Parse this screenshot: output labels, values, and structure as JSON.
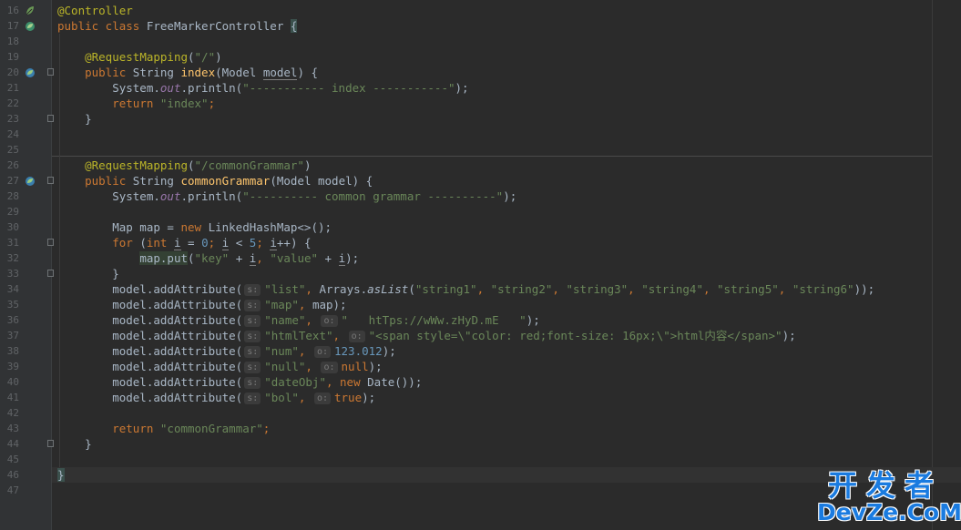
{
  "editor": {
    "lines": [
      {
        "n": "16",
        "icon": "spring-bean-icon",
        "segments": [
          {
            "c": "ann",
            "t": "@Controller"
          }
        ]
      },
      {
        "n": "17",
        "icon": "spring-bean-method-icon",
        "segments": [
          {
            "c": "kw",
            "t": "public class "
          },
          {
            "c": "",
            "t": "FreeMarkerController "
          },
          {
            "c": "hlb",
            "t": "{"
          }
        ]
      },
      {
        "n": "18",
        "segments": []
      },
      {
        "n": "19",
        "segments": [
          {
            "c": "",
            "t": "    "
          },
          {
            "c": "ann",
            "t": "@RequestMapping"
          },
          {
            "c": "",
            "t": "("
          },
          {
            "c": "str",
            "t": "\"/\""
          },
          {
            "c": "",
            "t": ")"
          }
        ]
      },
      {
        "n": "20",
        "icon": "spring-mapping-icon",
        "fold": true,
        "segments": [
          {
            "c": "",
            "t": "    "
          },
          {
            "c": "kw",
            "t": "public "
          },
          {
            "c": "",
            "t": "String "
          },
          {
            "c": "fn",
            "t": "index"
          },
          {
            "c": "",
            "t": "(Model "
          },
          {
            "c": "ul",
            "t": "model"
          },
          {
            "c": "",
            "t": ") {"
          }
        ]
      },
      {
        "n": "21",
        "segments": [
          {
            "c": "",
            "t": "        System."
          },
          {
            "c": "fld",
            "t": "out"
          },
          {
            "c": "",
            "t": ".println("
          },
          {
            "c": "str",
            "t": "\"----------- index -----------\""
          },
          {
            "c": "",
            "t": ");"
          }
        ]
      },
      {
        "n": "22",
        "segments": [
          {
            "c": "",
            "t": "        "
          },
          {
            "c": "kw",
            "t": "return "
          },
          {
            "c": "str",
            "t": "\"index\""
          },
          {
            "c": "kw",
            "t": ";"
          }
        ]
      },
      {
        "n": "23",
        "fold": true,
        "segments": [
          {
            "c": "",
            "t": "    }"
          }
        ]
      },
      {
        "n": "24",
        "segments": []
      },
      {
        "n": "25",
        "segments": []
      },
      {
        "n": "26",
        "segments": [
          {
            "c": "",
            "t": "    "
          },
          {
            "c": "ann",
            "t": "@RequestMapping"
          },
          {
            "c": "",
            "t": "("
          },
          {
            "c": "str",
            "t": "\"/commonGrammar\""
          },
          {
            "c": "",
            "t": ")"
          }
        ]
      },
      {
        "n": "27",
        "icon": "spring-mapping-icon",
        "fold": true,
        "segments": [
          {
            "c": "",
            "t": "    "
          },
          {
            "c": "kw",
            "t": "public "
          },
          {
            "c": "",
            "t": "String "
          },
          {
            "c": "fn",
            "t": "commonGrammar"
          },
          {
            "c": "",
            "t": "(Model model) {"
          }
        ]
      },
      {
        "n": "28",
        "segments": [
          {
            "c": "",
            "t": "        System."
          },
          {
            "c": "fld",
            "t": "out"
          },
          {
            "c": "",
            "t": ".println("
          },
          {
            "c": "str",
            "t": "\"---------- common grammar ----------\""
          },
          {
            "c": "",
            "t": ");"
          }
        ]
      },
      {
        "n": "29",
        "segments": []
      },
      {
        "n": "30",
        "segments": [
          {
            "c": "",
            "t": "        Map map = "
          },
          {
            "c": "kw",
            "t": "new "
          },
          {
            "c": "",
            "t": "LinkedHashMap<>();"
          }
        ]
      },
      {
        "n": "31",
        "fold": true,
        "segments": [
          {
            "c": "",
            "t": "        "
          },
          {
            "c": "kw",
            "t": "for "
          },
          {
            "c": "",
            "t": "("
          },
          {
            "c": "kw",
            "t": "int "
          },
          {
            "c": "ul",
            "t": "i"
          },
          {
            "c": "",
            "t": " = "
          },
          {
            "c": "num",
            "t": "0"
          },
          {
            "c": "kw",
            "t": "; "
          },
          {
            "c": "ul",
            "t": "i"
          },
          {
            "c": "",
            "t": " < "
          },
          {
            "c": "num",
            "t": "5"
          },
          {
            "c": "kw",
            "t": "; "
          },
          {
            "c": "ul",
            "t": "i"
          },
          {
            "c": "",
            "t": "++) {"
          }
        ]
      },
      {
        "n": "32",
        "segments": [
          {
            "c": "",
            "t": "            "
          },
          {
            "c": "hl",
            "t": "map.put"
          },
          {
            "c": "",
            "t": "("
          },
          {
            "c": "str",
            "t": "\"key\""
          },
          {
            "c": "",
            "t": " + "
          },
          {
            "c": "ul",
            "t": "i"
          },
          {
            "c": "kw",
            "t": ", "
          },
          {
            "c": "str",
            "t": "\"value\""
          },
          {
            "c": "",
            "t": " + "
          },
          {
            "c": "ul",
            "t": "i"
          },
          {
            "c": "",
            "t": ");"
          }
        ]
      },
      {
        "n": "33",
        "fold": true,
        "segments": [
          {
            "c": "",
            "t": "        }"
          }
        ]
      },
      {
        "n": "34",
        "segments": [
          {
            "c": "",
            "t": "        model.addAttribute("
          },
          {
            "c": "hint",
            "t": "s:"
          },
          {
            "c": "str",
            "t": "\"list\""
          },
          {
            "c": "kw",
            "t": ", "
          },
          {
            "c": "",
            "t": "Arrays."
          },
          {
            "c": "ital",
            "t": "asList"
          },
          {
            "c": "",
            "t": "("
          },
          {
            "c": "str",
            "t": "\"string1\""
          },
          {
            "c": "kw",
            "t": ", "
          },
          {
            "c": "str",
            "t": "\"string2\""
          },
          {
            "c": "kw",
            "t": ", "
          },
          {
            "c": "str",
            "t": "\"string3\""
          },
          {
            "c": "kw",
            "t": ", "
          },
          {
            "c": "str",
            "t": "\"string4\""
          },
          {
            "c": "kw",
            "t": ", "
          },
          {
            "c": "str",
            "t": "\"string5\""
          },
          {
            "c": "kw",
            "t": ", "
          },
          {
            "c": "str",
            "t": "\"string6\""
          },
          {
            "c": "",
            "t": "));"
          }
        ]
      },
      {
        "n": "35",
        "segments": [
          {
            "c": "",
            "t": "        model.addAttribute("
          },
          {
            "c": "hint",
            "t": "s:"
          },
          {
            "c": "str",
            "t": "\"map\""
          },
          {
            "c": "kw",
            "t": ", "
          },
          {
            "c": "",
            "t": "map);"
          }
        ]
      },
      {
        "n": "36",
        "segments": [
          {
            "c": "",
            "t": "        model.addAttribute("
          },
          {
            "c": "hint",
            "t": "s:"
          },
          {
            "c": "str",
            "t": "\"name\""
          },
          {
            "c": "kw",
            "t": ", "
          },
          {
            "c": "hint",
            "t": "o:"
          },
          {
            "c": "str",
            "t": "\"   htTps://wWw.zHyD.mE   \""
          },
          {
            "c": "",
            "t": ");"
          }
        ]
      },
      {
        "n": "37",
        "segments": [
          {
            "c": "",
            "t": "        model.addAttribute("
          },
          {
            "c": "hint",
            "t": "s:"
          },
          {
            "c": "str",
            "t": "\"htmlText\""
          },
          {
            "c": "kw",
            "t": ", "
          },
          {
            "c": "hint",
            "t": "o:"
          },
          {
            "c": "str",
            "t": "\"<span style=\\\"color: red;font-size: 16px;\\\">html内容</span>\""
          },
          {
            "c": "",
            "t": ");"
          }
        ]
      },
      {
        "n": "38",
        "segments": [
          {
            "c": "",
            "t": "        model.addAttribute("
          },
          {
            "c": "hint",
            "t": "s:"
          },
          {
            "c": "str",
            "t": "\"num\""
          },
          {
            "c": "kw",
            "t": ", "
          },
          {
            "c": "hint",
            "t": "o:"
          },
          {
            "c": "num",
            "t": "123.012"
          },
          {
            "c": "",
            "t": ");"
          }
        ]
      },
      {
        "n": "39",
        "segments": [
          {
            "c": "",
            "t": "        model.addAttribute("
          },
          {
            "c": "hint",
            "t": "s:"
          },
          {
            "c": "str",
            "t": "\"null\""
          },
          {
            "c": "kw",
            "t": ", "
          },
          {
            "c": "hint",
            "t": "o:"
          },
          {
            "c": "kw",
            "t": "null"
          },
          {
            "c": "",
            "t": ");"
          }
        ]
      },
      {
        "n": "40",
        "segments": [
          {
            "c": "",
            "t": "        model.addAttribute("
          },
          {
            "c": "hint",
            "t": "s:"
          },
          {
            "c": "str",
            "t": "\"dateObj\""
          },
          {
            "c": "kw",
            "t": ", new "
          },
          {
            "c": "",
            "t": "Date());"
          }
        ]
      },
      {
        "n": "41",
        "segments": [
          {
            "c": "",
            "t": "        model.addAttribute("
          },
          {
            "c": "hint",
            "t": "s:"
          },
          {
            "c": "str",
            "t": "\"bol\""
          },
          {
            "c": "kw",
            "t": ", "
          },
          {
            "c": "hint",
            "t": "o:"
          },
          {
            "c": "kw",
            "t": "true"
          },
          {
            "c": "",
            "t": ");"
          }
        ]
      },
      {
        "n": "42",
        "segments": []
      },
      {
        "n": "43",
        "segments": [
          {
            "c": "",
            "t": "        "
          },
          {
            "c": "kw",
            "t": "return "
          },
          {
            "c": "str",
            "t": "\"commonGrammar\""
          },
          {
            "c": "kw",
            "t": ";"
          }
        ]
      },
      {
        "n": "44",
        "fold": true,
        "segments": [
          {
            "c": "",
            "t": "    }"
          }
        ]
      },
      {
        "n": "45",
        "segments": []
      },
      {
        "n": "46",
        "current": true,
        "segments": [
          {
            "c": "hlb",
            "t": "}"
          }
        ]
      },
      {
        "n": "47",
        "segments": []
      }
    ]
  },
  "watermark": {
    "cn": "开发者",
    "en": "DevZe.CoM"
  },
  "colors": {
    "background": "#2b2b2b",
    "keyword": "#cc7832",
    "string": "#6a8759",
    "annotation": "#bbb529",
    "number": "#6897bb",
    "watermark": "#1a7be0"
  }
}
